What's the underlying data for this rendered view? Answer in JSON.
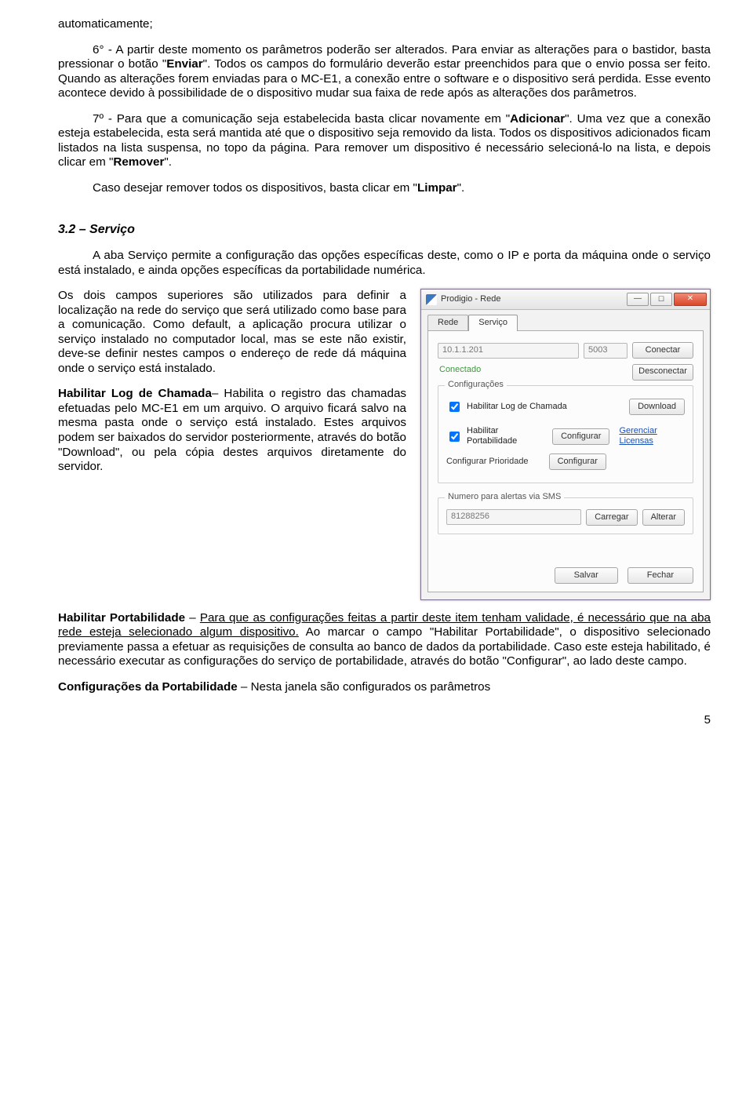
{
  "doc": {
    "p1": "automaticamente;",
    "p2a": "6° - A partir deste momento os parâmetros poderão ser alterados. Para enviar as alterações para o bastidor, basta pressionar o botão \"",
    "p2b": "Enviar",
    "p2c": "\". Todos os campos do formulário deverão estar preenchidos para que o envio possa ser feito. Quando as alterações forem enviadas para o MC-E1, a conexão entre o software e o dispositivo será perdida. Esse evento acontece devido à possibilidade de o dispositivo mudar sua faixa de rede após as alterações dos parâmetros.",
    "p3a": "7º - Para que a comunicação seja estabelecida basta clicar novamente em \"",
    "p3b": "Adicionar",
    "p3c": "\". Uma vez que a conexão esteja estabelecida, esta será mantida até que o dispositivo seja removido da lista. Todos os dispositivos adicionados ficam listados na lista suspensa, no topo da página. Para remover um dispositivo é necessário selecioná-lo na lista, e depois clicar em \"",
    "p3d": "Remover",
    "p3e": "\".",
    "p4a": "Caso desejar remover todos os dispositivos, basta clicar em \"",
    "p4b": "Limpar",
    "p4c": "\".",
    "sec_title": "3.2 – Serviço",
    "p5": "A aba Serviço permite a configuração das opções específicas deste, como o IP e porta da máquina onde o serviço está instalado, e ainda opções específicas da portabilidade numérica.",
    "p6": "Os dois campos superiores são utilizados para definir a localização na rede do serviço que será utilizado como base para a comunicação. Como default, a aplicação procura utilizar o serviço instalado no computador local, mas se este não existir, deve-se definir nestes campos o endereço de rede dá máquina onde o serviço está instalado.",
    "p7a": "Habilitar Log de Chamada",
    "p7b": "– Habilita o registro das chamadas efetuadas pelo MC-E1 em um arquivo. O arquivo ficará salvo na mesma pasta onde o serviço está instalado. Estes arquivos podem ser baixados do servidor posteriormente, através do botão \"Download\", ou pela cópia destes arquivos diretamente do servidor.",
    "p8a": "Habilitar Portabilidade",
    "p8b": " – ",
    "p8c": "Para que as configurações feitas a partir deste item tenham validade, é necessário que na aba rede esteja selecionado algum dispositivo.",
    "p8d": " Ao marcar o campo \"Habilitar Portabilidade\", o dispositivo selecionado previamente passa a efetuar as requisições de consulta ao banco de dados da portabilidade. Caso este esteja habilitado, é necessário executar as configurações do serviço de portabilidade, através do botão \"Configurar\", ao lado deste campo.",
    "p9a": "Configurações da Portabilidade",
    "p9b": " – Nesta janela são configurados os parâmetros",
    "page_num": "5"
  },
  "win": {
    "title": "Prodigio - Rede",
    "tabs": {
      "rede": "Rede",
      "servico": "Serviço"
    },
    "ip": "10.1.1.201",
    "port": "5003",
    "btn_connect": "Conectar",
    "btn_disconnect": "Desconectar",
    "status": "Conectado",
    "group_cfg": "Configurações",
    "chk_log": "Habilitar Log de Chamada",
    "btn_download": "Download",
    "chk_port": "Habilitar Portabilidade",
    "btn_config": "Configurar",
    "link_lic": "Gerenciar Licensas",
    "lbl_prio": "Configurar Prioridade",
    "group_sms": "Numero para alertas via SMS",
    "sms_num": "81288256",
    "btn_load": "Carregar",
    "btn_alter": "Alterar",
    "btn_save": "Salvar",
    "btn_close": "Fechar"
  }
}
